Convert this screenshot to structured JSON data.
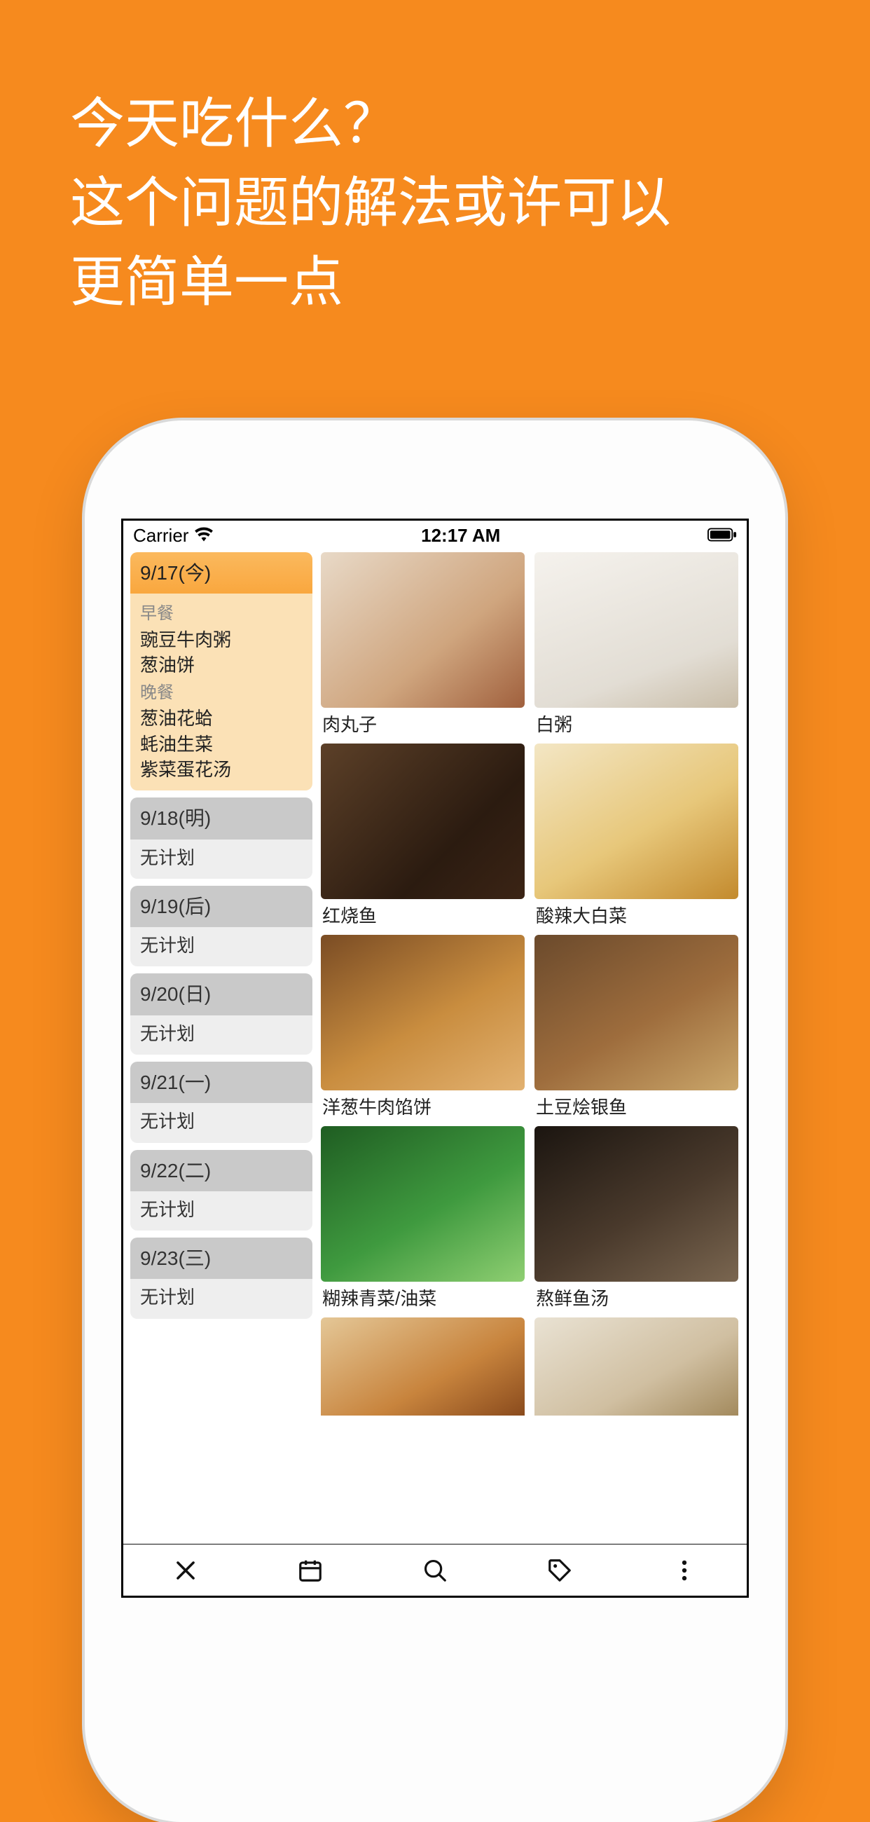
{
  "hero": {
    "line1": "今天吃什么？",
    "line2": "这个问题的解法或许可以",
    "line3": "更简单一点"
  },
  "status": {
    "carrier": "Carrier",
    "time": "12:17 AM"
  },
  "sidebar": {
    "no_plan": "无计划",
    "days": [
      {
        "date": "9/17(今)",
        "selected": true,
        "sections": [
          {
            "label": "早餐",
            "items": [
              "豌豆牛肉粥",
              "葱油饼"
            ]
          },
          {
            "label": "晚餐",
            "items": [
              "葱油花蛤",
              "蚝油生菜",
              "紫菜蛋花汤"
            ]
          }
        ]
      },
      {
        "date": "9/18(明)"
      },
      {
        "date": "9/19(后)"
      },
      {
        "date": "9/20(日)"
      },
      {
        "date": "9/21(一)"
      },
      {
        "date": "9/22(二)"
      },
      {
        "date": "9/23(三)"
      }
    ]
  },
  "dishes": [
    {
      "name": "肉丸子",
      "bg": "linear-gradient(140deg,#e8d9c7,#cfa57e 60%,#a0603d)"
    },
    {
      "name": "白粥",
      "bg": "linear-gradient(160deg,#f5f2ed,#e2ddd4 70%,#c9bda8)"
    },
    {
      "name": "红烧鱼",
      "bg": "linear-gradient(135deg,#5c4028,#2b1b10 65%,#3b2415)"
    },
    {
      "name": "酸辣大白菜",
      "bg": "linear-gradient(150deg,#f3e6c4,#e7c77a 55%,#c38a2d)"
    },
    {
      "name": "洋葱牛肉馅饼",
      "bg": "linear-gradient(150deg,#7a4c24,#c98d3f 55%,#e2b170)"
    },
    {
      "name": "土豆烩银鱼",
      "bg": "linear-gradient(150deg,#6b4a2c,#9e6d3d 55%,#caa66a)"
    },
    {
      "name": "糊辣青菜/油菜",
      "bg": "linear-gradient(150deg,#1f5d22,#3f9a3f 55%,#8fcf72)"
    },
    {
      "name": "熬鲜鱼汤",
      "bg": "linear-gradient(150deg,#1b1510,#4a3a2c 55%,#7a6650)"
    }
  ],
  "partial_dishes": [
    {
      "bg": "linear-gradient(150deg,#e4c797,#c8843d 60%,#8a4b1d)"
    },
    {
      "bg": "linear-gradient(150deg,#e9e2d3,#d0bfa1 60%,#a38a5d)"
    }
  ],
  "tabs": {
    "close": "close-icon",
    "calendar": "calendar-icon",
    "search": "search-icon",
    "tag": "tag-icon",
    "more": "more-icon"
  }
}
